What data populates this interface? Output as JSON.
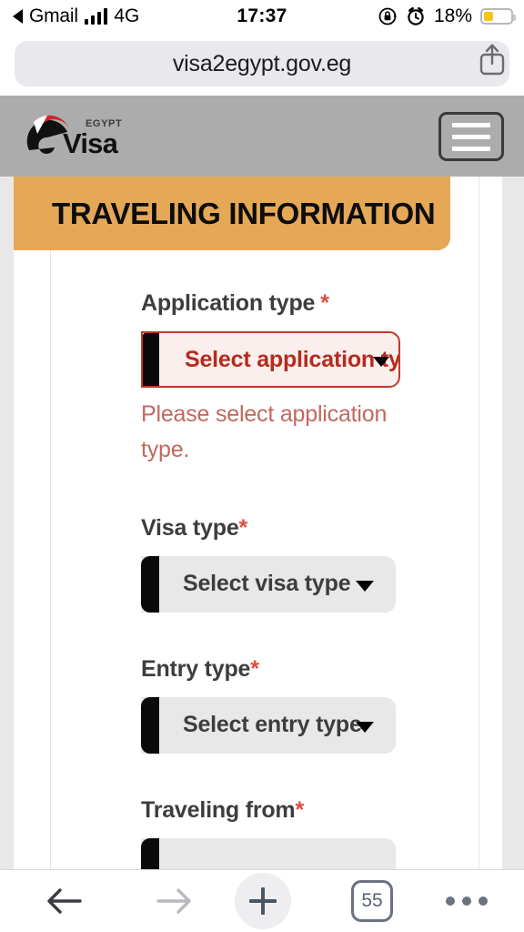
{
  "statusbar": {
    "back_app": "Gmail",
    "network": "4G",
    "time": "17:37",
    "battery_percent": "18%",
    "rotation_lock_icon": "rotation-lock-icon",
    "alarm_icon": "alarm-clock-icon",
    "signal_icon": "signal-bars-icon"
  },
  "browser": {
    "url": "visa2egypt.gov.eg",
    "share_icon": "share-icon",
    "toolbar": {
      "back_icon": "back-arrow-icon",
      "forward_icon": "forward-arrow-icon",
      "add_icon": "plus-icon",
      "tabs_count": "55",
      "more_icon": "more-dots-icon"
    }
  },
  "site_header": {
    "logo_egypt": "EGYPT",
    "logo_visa": "Visa",
    "menu_icon": "hamburger-menu-icon"
  },
  "banner": {
    "title": "TRAVELING INFORMATION"
  },
  "form": {
    "fields": [
      {
        "label": "Application type",
        "required_marker": "*",
        "value": "Select application type",
        "state": "error",
        "error": "Please select application type."
      },
      {
        "label": "Visa type",
        "required_marker": "*",
        "value": "Select visa type",
        "state": "normal"
      },
      {
        "label": "Entry type",
        "required_marker": "*",
        "value": "Select entry type",
        "state": "normal"
      },
      {
        "label": "Traveling from",
        "required_marker": "*",
        "value": "",
        "state": "partial"
      }
    ]
  },
  "colors": {
    "banner_orange": "#e5a857",
    "header_grey": "#acacac",
    "error_red": "#c0392b",
    "error_text": "#c2685e",
    "required_star": "#e04b3d",
    "select_grey": "#e8e8e8",
    "battery_yellow": "#f5c518"
  }
}
